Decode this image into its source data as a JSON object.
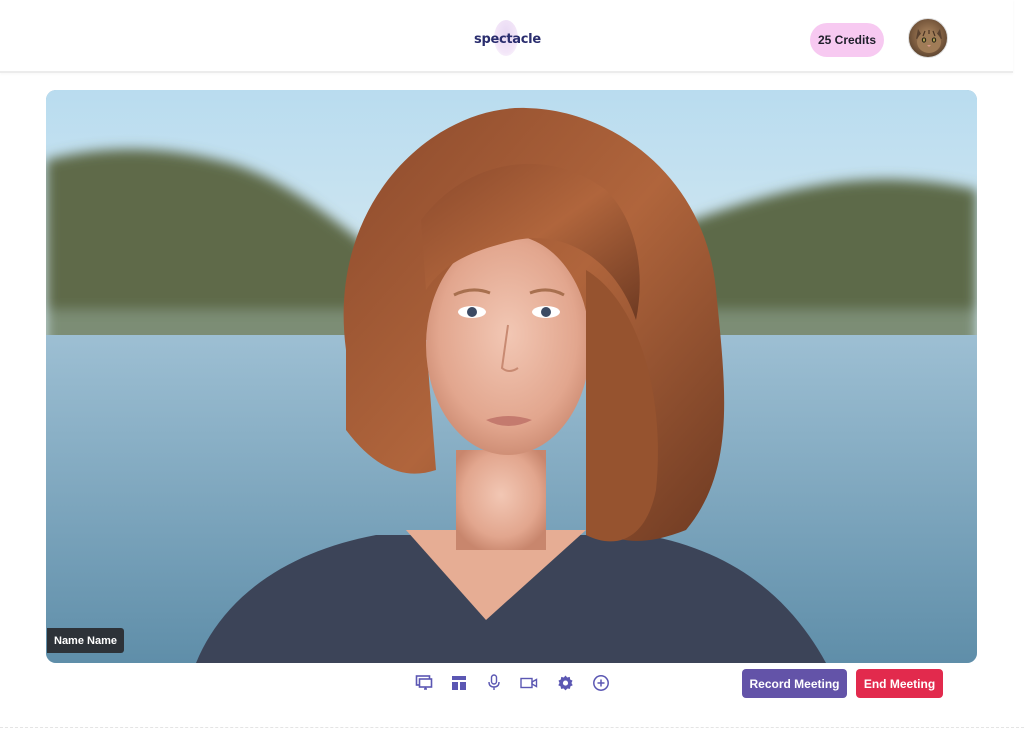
{
  "header": {
    "logo_text": "spectacle",
    "credits_label": "25 Credits",
    "avatar_icon": "cat-avatar-icon"
  },
  "video": {
    "participant_name": "Name Name"
  },
  "toolbar": {
    "icons": [
      "screen-share-icon",
      "layout-icon",
      "microphone-icon",
      "camera-icon",
      "settings-gear-icon",
      "add-circle-icon"
    ],
    "icon_color": "#5b57b3",
    "record_label": "Record Meeting",
    "end_label": "End Meeting"
  },
  "colors": {
    "credits_bg": "#f7c9f1",
    "record_bg": "#6353a8",
    "end_bg": "#e22a4d",
    "name_tag_bg": "#2d3238"
  }
}
